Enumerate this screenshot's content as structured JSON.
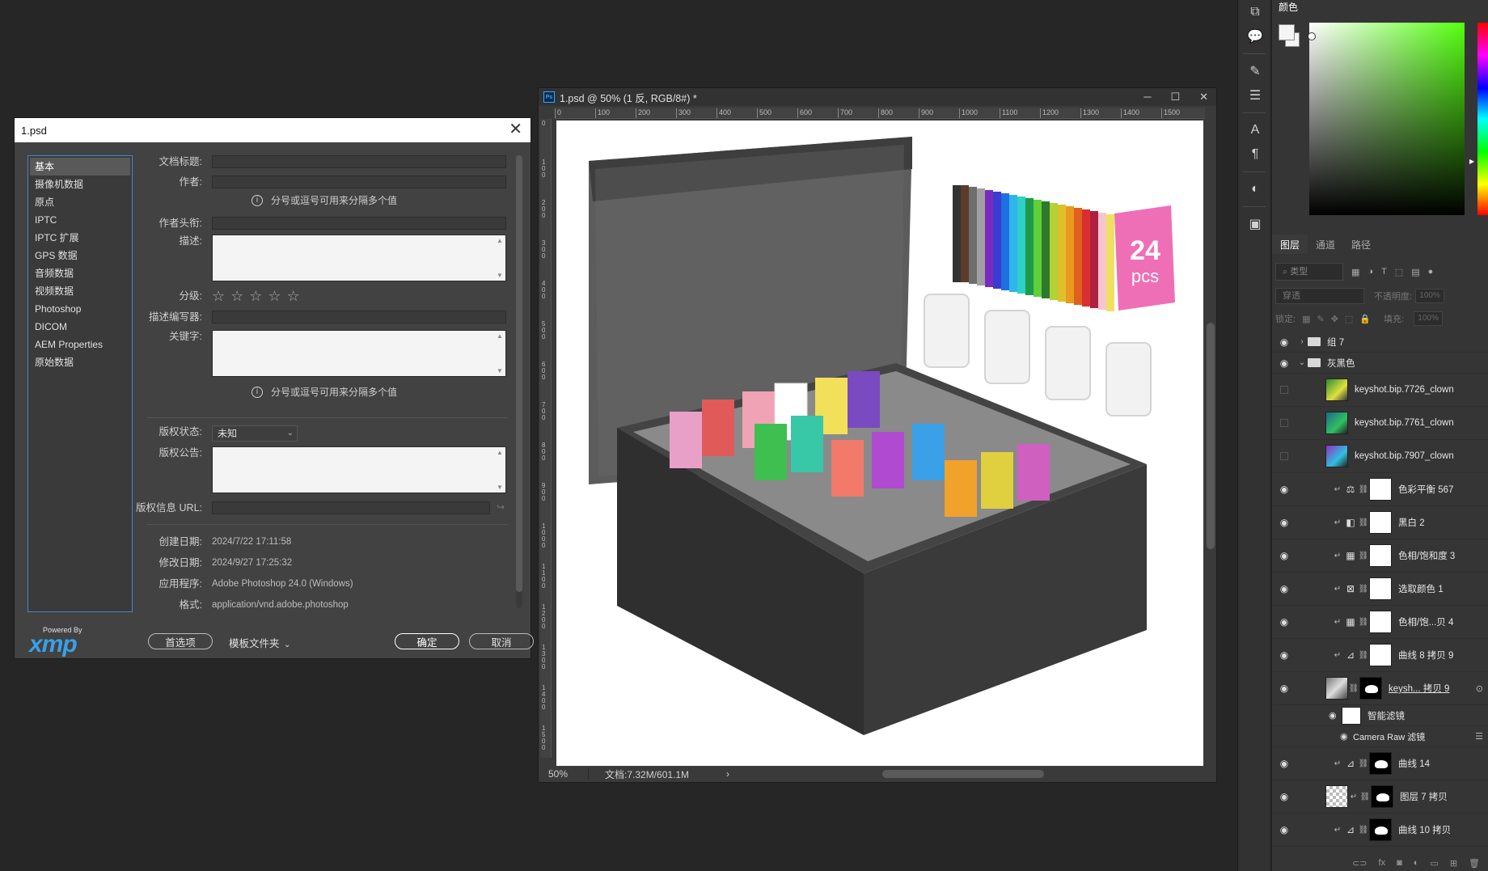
{
  "dialog": {
    "title": "1.psd",
    "categories": [
      "基本",
      "摄像机数据",
      "原点",
      "IPTC",
      "IPTC 扩展",
      "GPS 数据",
      "音频数据",
      "视频数据",
      "Photoshop",
      "DICOM",
      "AEM Properties",
      "原始数据"
    ],
    "fields": {
      "doc_title": "文档标题:",
      "author": "作者:",
      "author_hint": "分号或逗号可用来分隔多个值",
      "author_title": "作者头衔:",
      "description": "描述:",
      "rating": "分级:",
      "desc_writer": "描述编写器:",
      "keywords": "关键字:",
      "keywords_hint": "分号或逗号可用来分隔多个值",
      "copyright_status": "版权状态:",
      "copyright_status_value": "未知",
      "copyright_notice": "版权公告:",
      "copyright_url": "版权信息 URL:",
      "created": "创建日期:",
      "created_value": "2024/7/22 17:11:58",
      "modified": "修改日期:",
      "modified_value": "2024/9/27 17:25:32",
      "app": "应用程序:",
      "app_value": "Adobe Photoshop 24.0 (Windows)",
      "format": "格式:",
      "format_value": "application/vnd.adobe.photoshop"
    },
    "powered_by": "Powered By",
    "xmp": "xmp",
    "buttons": {
      "preferences": "首选项",
      "template_folder": "模板文件夹",
      "ok": "确定",
      "cancel": "取消"
    }
  },
  "document": {
    "title": "1.psd @ 50% (1 反, RGB/8#) *",
    "ruler_h": [
      "0",
      "100",
      "200",
      "300",
      "400",
      "500",
      "600",
      "700",
      "800",
      "900",
      "1000",
      "1100",
      "1200",
      "1300",
      "1400",
      "1500"
    ],
    "ruler_v": [
      "0",
      "100",
      "200",
      "300",
      "400",
      "500",
      "600",
      "700",
      "800",
      "900",
      "1000",
      "1100",
      "1200",
      "1300",
      "1400",
      "1500"
    ],
    "zoom": "50%",
    "doc_size": "文档:7.32M/601.1M",
    "badge_number": "24",
    "badge_unit": "pcs"
  },
  "panel": {
    "color_tab": "颜色",
    "tabs": [
      "图层",
      "通道",
      "路径"
    ],
    "filter_kind": "类型",
    "blend_mode": "穿透",
    "opacity_label": "不透明度:",
    "opacity_value": "100%",
    "lock_label": "锁定:",
    "fill_label": "填充:",
    "fill_value": "100%",
    "layers": [
      {
        "name": "组 7",
        "kind": "folder",
        "visible": true
      },
      {
        "name": "灰黑色",
        "kind": "folder-open",
        "visible": true
      },
      {
        "name": "keyshot.bip.7726_clown",
        "kind": "image",
        "visible": false
      },
      {
        "name": "keyshot.bip.7761_clown",
        "kind": "image",
        "visible": false
      },
      {
        "name": "keyshot.bip.7907_clown",
        "kind": "image",
        "visible": false
      },
      {
        "name": "色彩平衡 567",
        "kind": "adj",
        "visible": true
      },
      {
        "name": "黑白 2",
        "kind": "adj",
        "visible": true
      },
      {
        "name": "色相/饱和度 3",
        "kind": "adj",
        "visible": true
      },
      {
        "name": "选取颜色 1",
        "kind": "adj",
        "visible": true
      },
      {
        "name": "色相/饱...贝 4",
        "kind": "adj",
        "visible": true
      },
      {
        "name": "曲线 8 拷贝 9",
        "kind": "adj",
        "visible": true
      },
      {
        "name": "keysh... 拷贝 9",
        "kind": "smart",
        "visible": true
      },
      {
        "name": "智能滤镜",
        "kind": "filter",
        "visible": true
      },
      {
        "name": "Camera Raw 滤镜",
        "kind": "filter-item",
        "visible": true
      },
      {
        "name": "曲线 14",
        "kind": "adj-mask",
        "visible": true
      },
      {
        "name": "图层 7 拷贝",
        "kind": "checker",
        "visible": true
      },
      {
        "name": "曲线 10 拷贝",
        "kind": "adj-mask",
        "visible": true
      }
    ]
  }
}
